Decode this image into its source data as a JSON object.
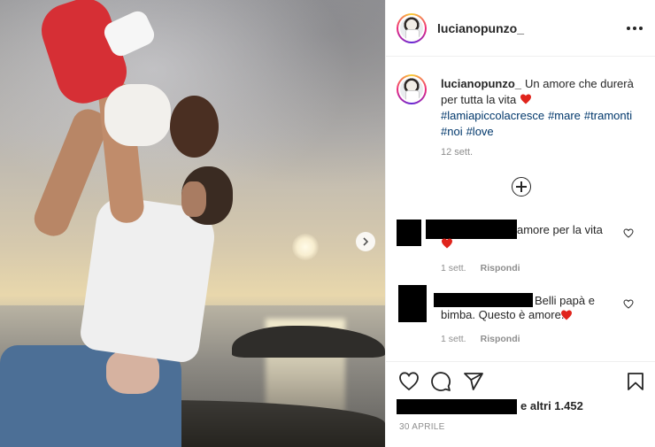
{
  "post": {
    "username": "lucianopunzo_",
    "caption_text": "Un amore che durerà per tutta la vita",
    "hashtags": [
      "#lamiapiccolacresce",
      "#mare",
      "#tramonti",
      "#noi",
      "#love"
    ],
    "caption_time": "12 sett.",
    "likes_text": "e altri 1.452",
    "date": "30 APRILE"
  },
  "comments": [
    {
      "text": "amore per la vita",
      "time": "1 sett.",
      "reply_label": "Rispondi"
    },
    {
      "text_line1": "Belli papà e",
      "text_line2": "bimba. Questo è amore.",
      "time": "1 sett.",
      "reply_label": "Rispondi"
    }
  ],
  "icons": {
    "more": "more-icon",
    "add": "add-comment-icon",
    "next": "chevron-right-icon",
    "like": "heart-icon",
    "comment": "comment-icon",
    "share": "send-icon",
    "save": "bookmark-icon"
  },
  "colors": {
    "hashtag": "#00376b",
    "heart_red": "#ed4956",
    "meta_gray": "#8e8e8e"
  }
}
